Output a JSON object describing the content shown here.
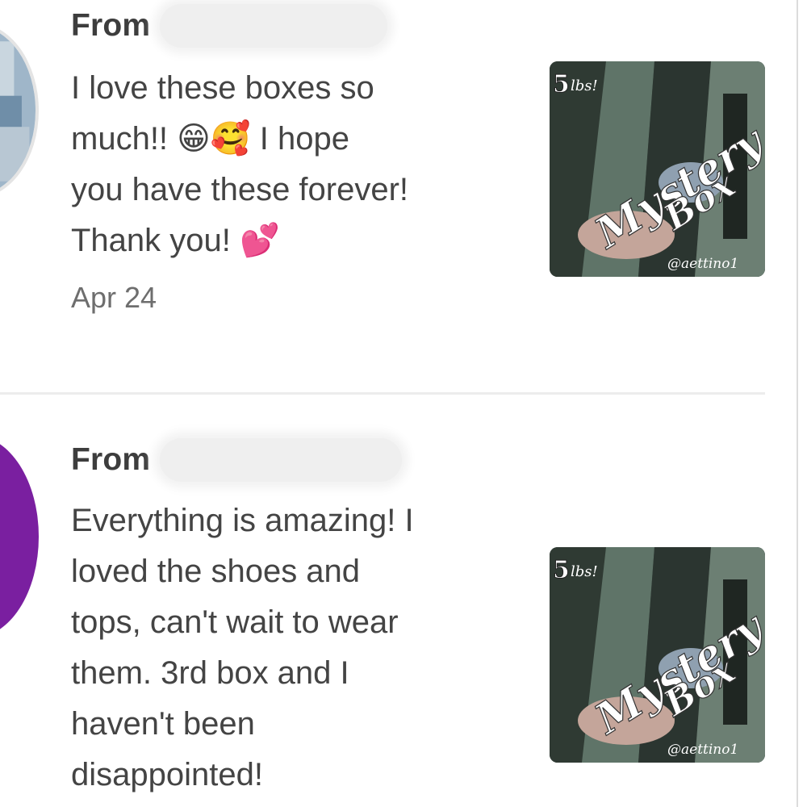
{
  "reviews": [
    {
      "from_label": "From",
      "text": "I love these boxes so\nmuch!! 😁🥰 I hope\nyou have these forever!\nThank you! 💕",
      "date": "Apr 24",
      "avatar_color": "#9fb6c9",
      "thumbnail": {
        "weight": "5",
        "unit": "lbs!",
        "title_line1": "Mystery",
        "title_line2": "Box",
        "handle": "@aettino1"
      }
    },
    {
      "from_label": "From",
      "text": "Everything is amazing! I\nloved the shoes and\ntops, can't wait to wear\nthem. 3rd box and I\nhaven't been\ndisappointed!",
      "avatar_color": "#7a1fa0",
      "thumbnail": {
        "weight": "5",
        "unit": "lbs!",
        "title_line1": "Mystery",
        "title_line2": "Box",
        "handle": "@aettino1"
      }
    }
  ]
}
